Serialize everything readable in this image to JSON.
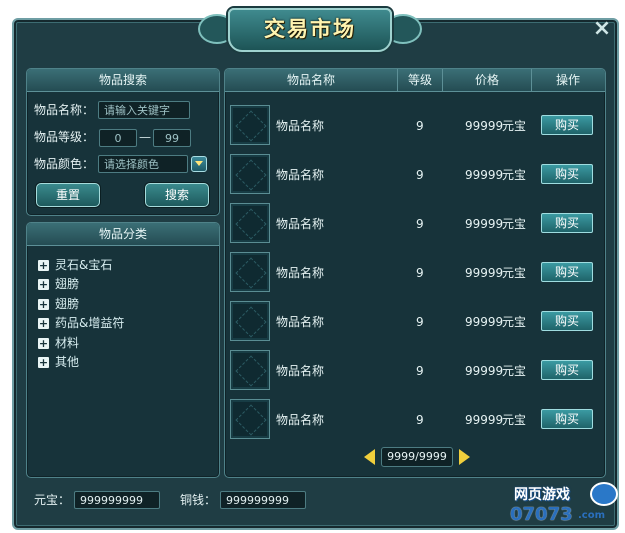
{
  "window": {
    "title": "交易市场",
    "close_glyph": "×"
  },
  "search": {
    "header": "物品搜索",
    "name_label": "物品名称：",
    "name_placeholder": "请输入关键字",
    "level_label": "物品等级：",
    "level_min": "0",
    "level_dash": "—",
    "level_max": "99",
    "color_label": "物品颜色：",
    "color_placeholder": "请选择颜色",
    "reset_label": "重置",
    "search_label": "搜索"
  },
  "category": {
    "header": "物品分类",
    "items": [
      "灵石&宝石",
      "翅膀",
      "翅膀",
      "药品&增益符",
      "材料",
      "其他"
    ]
  },
  "table": {
    "columns": [
      "物品名称",
      "等级",
      "价格",
      "操作"
    ],
    "rows": [
      {
        "name": "物品名称",
        "level": "9",
        "price": "99999",
        "currency": "元宝",
        "action": "购买"
      },
      {
        "name": "物品名称",
        "level": "9",
        "price": "99999",
        "currency": "元宝",
        "action": "购买"
      },
      {
        "name": "物品名称",
        "level": "9",
        "price": "99999",
        "currency": "元宝",
        "action": "购买"
      },
      {
        "name": "物品名称",
        "level": "9",
        "price": "99999",
        "currency": "元宝",
        "action": "购买"
      },
      {
        "name": "物品名称",
        "level": "9",
        "price": "99999",
        "currency": "元宝",
        "action": "购买"
      },
      {
        "name": "物品名称",
        "level": "9",
        "price": "99999",
        "currency": "元宝",
        "action": "购买"
      },
      {
        "name": "物品名称",
        "level": "9",
        "price": "99999",
        "currency": "元宝",
        "action": "购买"
      }
    ]
  },
  "pager": {
    "page": "9999/9999"
  },
  "footer": {
    "yuanbao_label": "元宝：",
    "yuanbao_value": "999999999",
    "tongqian_label": "铜钱：",
    "tongqian_value": "999999999"
  },
  "watermark": {
    "line1": "网页游戏",
    "line2": "07073",
    "suffix": ".com"
  },
  "colors": {
    "frame_bg": "#1f3d44",
    "panel_bg": "#17333a",
    "accent": "#ffe57a",
    "border": "#6f9ea4"
  }
}
